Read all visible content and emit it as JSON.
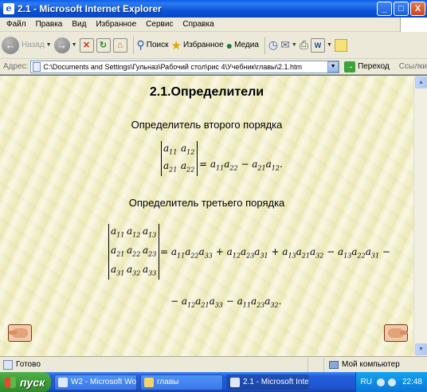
{
  "window": {
    "title": "2.1 - Microsoft Internet Explorer",
    "app_icon": "e",
    "min_icon": "_",
    "max_icon": "□",
    "close_icon": "X"
  },
  "menu": [
    "Файл",
    "Правка",
    "Вид",
    "Избранное",
    "Сервис",
    "Справка"
  ],
  "toolbar": {
    "back_label": "Назад",
    "search_label": "Поиск",
    "favorites_label": "Избранное",
    "media_label": "Медиа"
  },
  "address": {
    "label": "Адрес:",
    "value": "C:\\Documents and Settings\\Гульназ\\Рабочий стол\\рис 4\\Учебник\\главы\\2.1.htm",
    "go_label": "Переход",
    "links_label": "Ссылки"
  },
  "page": {
    "title": "2.1.Определители",
    "subtitle_2": "Определитель второго порядка",
    "subtitle_3": "Определитель третьего порядка",
    "det2_cells": [
      "a11",
      "a12",
      "a21",
      "a22"
    ],
    "det2_rhs": "= a11a22 − a21a12.",
    "det3_cells": [
      "a11",
      "a12",
      "a13",
      "a21",
      "a22",
      "a23",
      "a31",
      "a32",
      "a33"
    ],
    "det3_rhs_line1": "= a11a22a33 + a12a23a31 + a13a21a32 − a13a22a31 −",
    "det3_rhs_line2": "− a12a21a33 − a11a23a32."
  },
  "status": {
    "text": "Готово",
    "zone": "Мой компьютер"
  },
  "taskbar": {
    "start_label": "пуск",
    "tasks": [
      "W2 - Microsoft Word",
      "главы",
      "2.1 - Microsoft Intern..."
    ],
    "lang": "RU",
    "clock": "22:48"
  }
}
